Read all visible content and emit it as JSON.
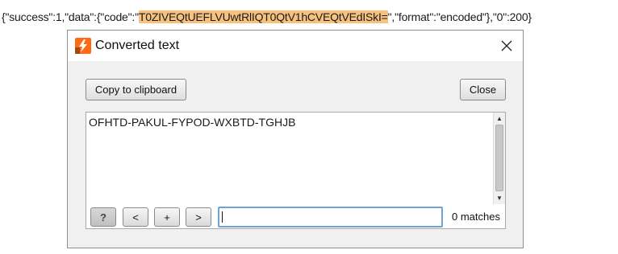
{
  "background": {
    "prefix": "{\"success\":1,\"data\":{\"code\":\"",
    "highlighted_code": "T0ZIVEQtUEFLVUwtRlIQT0QtV1hCVEQtVEdISkI=",
    "suffix": "\",\"format\":\"encoded\"},\"0\":200}",
    "highlight_color": "#f7c27e"
  },
  "dialog": {
    "title": "Converted text",
    "icon": "burp-suite-icon",
    "copy_button": "Copy to clipboard",
    "close_button": "Close",
    "text_content": "OFHTD-PAKUL-FYPOD-WXBTD-TGHJB",
    "search": {
      "help_label": "?",
      "prev_label": "<",
      "add_label": "+",
      "next_label": ">",
      "input_value": "",
      "matches_text": "0 matches"
    }
  },
  "colors": {
    "accent": "#f7c27e",
    "icon_orange": "#ff6a13",
    "input_focus": "#6fa3d6"
  }
}
